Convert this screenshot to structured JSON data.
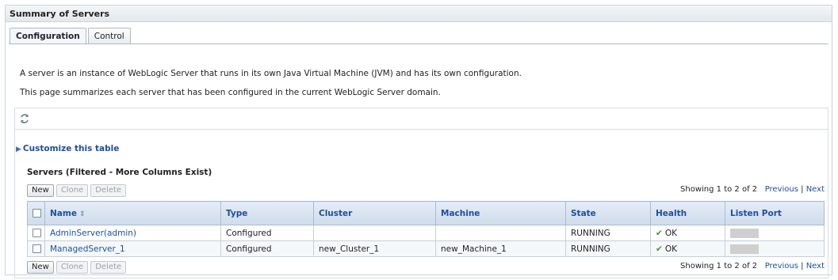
{
  "page": {
    "title": "Summary of Servers",
    "tabs": [
      {
        "label": "Configuration",
        "active": true
      },
      {
        "label": "Control",
        "active": false
      }
    ],
    "description_1": "A server is an instance of WebLogic Server that runs in its own Java Virtual Machine (JVM) and has its own configuration.",
    "description_2": "This page summarizes each server that has been configured in the current WebLogic Server domain."
  },
  "table_section": {
    "refresh_icon": "refresh-icon",
    "customize_label": "Customize this table",
    "title": "Servers (Filtered - More Columns Exist)",
    "buttons": {
      "new": "New",
      "clone": "Clone",
      "delete": "Delete"
    },
    "pagination": {
      "showing": "Showing 1 to 2 of 2",
      "previous": "Previous",
      "separator": "|",
      "next": "Next"
    },
    "columns": [
      "Name",
      "Type",
      "Cluster",
      "Machine",
      "State",
      "Health",
      "Listen Port"
    ],
    "rows": [
      {
        "name": "AdminServer(admin)",
        "type": "Configured",
        "cluster": "",
        "machine": "",
        "state": "RUNNING",
        "health": "OK"
      },
      {
        "name": "ManagedServer_1",
        "type": "Configured",
        "cluster": "new_Cluster_1",
        "machine": "new_Machine_1",
        "state": "RUNNING",
        "health": "OK"
      }
    ]
  },
  "colors": {
    "link": "#1f4e9e",
    "header_bg": "#dbe5f1",
    "ok": "#3a9a2a"
  }
}
